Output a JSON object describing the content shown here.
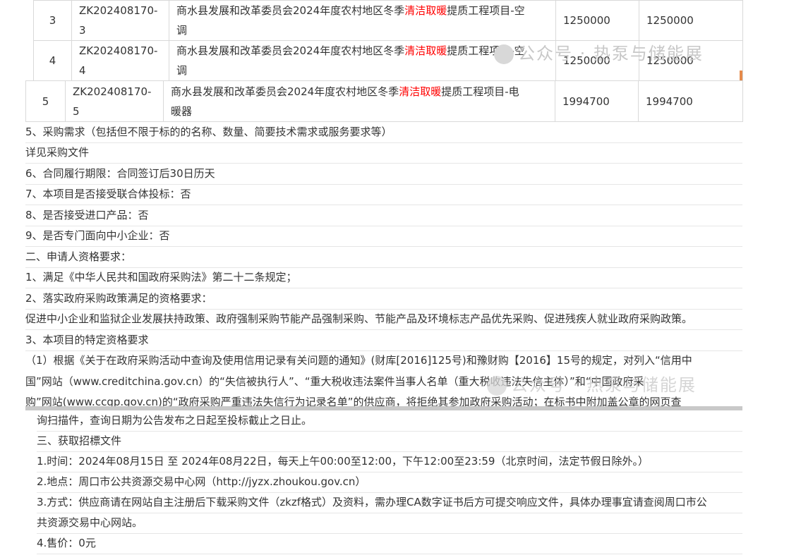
{
  "table_rows": [
    {
      "no": "3",
      "code1": "ZK202408170-",
      "code2": "3",
      "name_pre": "商水县发展和改革委员会2024年度农村地区冬季",
      "name_hl": "清洁取暖",
      "name_post": "提质工程项目-空",
      "name_line2": "调",
      "budget": "1250000",
      "max_price": "1250000"
    },
    {
      "no": "4",
      "code1": "ZK202408170-",
      "code2": "4",
      "name_pre": "商水县发展和改革委员会2024年度农村地区冬季",
      "name_hl": "清洁取暖",
      "name_post": "提质工程项目-空",
      "name_line2": "调",
      "budget": "1250000",
      "max_price": "1250000"
    },
    {
      "no": "5",
      "code1": "ZK202408170-",
      "code2": "5",
      "name_pre": "商水县发展和改革委员会2024年度农村地区冬季",
      "name_hl": "清洁取暖",
      "name_post": "提质工程项目-电",
      "name_line2": "暖器",
      "budget": "1994700",
      "max_price": "1994700"
    }
  ],
  "lines": [
    "5、采购需求（包括但不限于标的的名称、数量、简要技术需求或服务要求等）",
    "详见采购文件",
    "6、合同履行期限：合同签订后30日历天",
    "7、本项目是否接受联合体投标：否",
    "8、是否接受进口产品：否",
    "9、是否专门面向中小企业：否",
    "二、申请人资格要求：",
    "1、满足《中华人民共和国政府采购法》第二十二条规定；",
    "2、落实政府采购政策满足的资格要求：",
    "促进中小企业和监狱企业发展扶持政策、政府强制采购节能产品强制采购、节能产品及环境标志产品优先采购、促进残疾人就业政府采购政策。",
    "3、本项目的特定资格要求"
  ],
  "para": [
    "（1）根据《关于在政府采购活动中查询及使用信用记录有关问题的通知》(财库[2016]125号)和豫财购【2016】15号的规定，对列入“信用中",
    "国”网站（www.creditchina.gov.cn）的“失信被执行人”、“重大税收违法案件当事人名单（重大税收违法失信主体）”和“中国政府采",
    "购”网站(www.ccgp.gov.cn)的“政府采购严重违法失信行为记录名单”的供应商，将拒绝其参加政府采购活动；在标书中附加盖公章的网页查"
  ],
  "lower_lines": [
    "询扫描件，查询日期为公告发布之日起至投标截止之日止。",
    "三、获取招標文件",
    "1.时间：2024年08月15日 至 2024年08月22日，每天上午00:00至12:00，下午12:00至23:59（北京时间，法定节假日除外。）",
    "2.地点：周口市公共资源交易中心网（http://jyzx.zhoukou.gov.cn）",
    "3.方式：供应商请在网站自主注册后下载采购文件（zkzf格式）及资料，需办理CA数字证书后方可提交响应文件，具体办理事宜请查阅周口市公",
    "共资源交易中心网站。",
    "4.售价：0元"
  ],
  "watermark": "公众号 · 热泵与储能展",
  "colors": {
    "highlight": "#ff0000",
    "text": "#333333",
    "border": "#d9d9d9",
    "watermark": "#c8c8c8"
  }
}
